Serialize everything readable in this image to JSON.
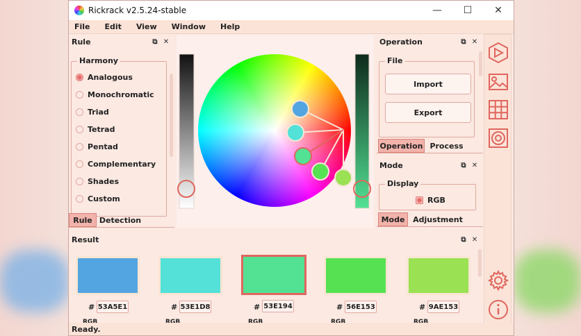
{
  "window": {
    "title": "Rickrack v2.5.24-stable"
  },
  "menu": [
    "File",
    "Edit",
    "View",
    "Window",
    "Help"
  ],
  "rule_panel": {
    "title": "Rule",
    "group_title": "Harmony",
    "options": [
      "Analogous",
      "Monochromatic",
      "Triad",
      "Tetrad",
      "Pentad",
      "Complementary",
      "Shades",
      "Custom"
    ],
    "selected": "Analogous",
    "tabs": [
      "Rule",
      "Detection"
    ]
  },
  "operation_panel": {
    "title": "Operation",
    "group_title": "File",
    "buttons": [
      "Import",
      "Export"
    ],
    "tabs": [
      "Operation",
      "Process"
    ]
  },
  "mode_panel": {
    "title": "Mode",
    "group_title": "Display",
    "option": "RGB",
    "tabs": [
      "Mode",
      "Adjustment"
    ]
  },
  "result_panel": {
    "title": "Result",
    "hash": "#",
    "rgb_label": "RGB",
    "swatches": [
      {
        "hex": "53A5E1",
        "color": "#53A5E1"
      },
      {
        "hex": "53E1D8",
        "color": "#53E1D8"
      },
      {
        "hex": "53E194",
        "color": "#53E194"
      },
      {
        "hex": "56E153",
        "color": "#56E153"
      },
      {
        "hex": "9AE153",
        "color": "#9AE153"
      }
    ],
    "selected_index": 2
  },
  "status": "Ready.",
  "colors": {
    "accent": "#E0665E",
    "panel_bg": "#FBE9E2",
    "border": "#E0A99E"
  },
  "icons": [
    "triangle-icon",
    "image-icon",
    "grid-icon",
    "wheel-icon",
    "gear-icon",
    "info-icon"
  ]
}
